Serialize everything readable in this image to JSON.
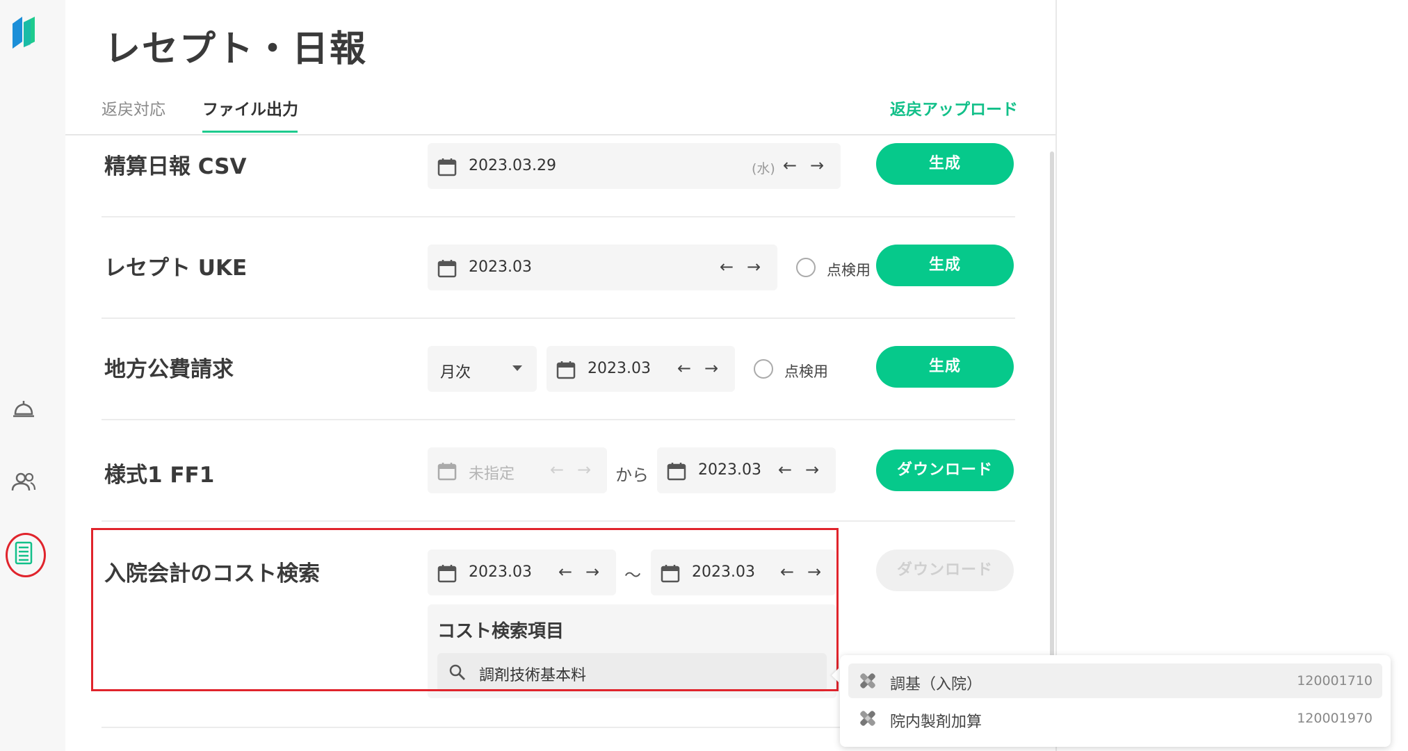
{
  "page": {
    "title": "レセプト・日報",
    "tabs": [
      {
        "label": "返戻対応",
        "active": false
      },
      {
        "label": "ファイル出力",
        "active": true
      }
    ],
    "upload_link": "返戻アップロード"
  },
  "colors": {
    "accent": "#06c98b",
    "annotation": "#e0242c"
  },
  "sidebar": {
    "icons": [
      "logo-icon",
      "bell-icon",
      "people-icon",
      "document-list-icon"
    ]
  },
  "rows": {
    "daily_csv": {
      "title": "精算日報 CSV",
      "date": "2023.03.29",
      "weekday": "(水)",
      "button": "生成"
    },
    "receipt_uke": {
      "title": "レセプト UKE",
      "date": "2023.03",
      "checkbox_label": "点検用",
      "button": "生成"
    },
    "local_public": {
      "title": "地方公費請求",
      "period_select": "月次",
      "date": "2023.03",
      "checkbox_label": "点検用",
      "button": "生成"
    },
    "form1_ff1": {
      "title": "様式1 FF1",
      "from_placeholder": "未指定",
      "from_text": "から",
      "to_date": "2023.03",
      "button": "ダウンロード"
    },
    "inpatient_cost": {
      "title": "入院会計のコスト検索",
      "start_date": "2023.03",
      "range_sep": "～",
      "end_date": "2023.03",
      "button": "ダウンロード",
      "cost_label": "コスト検索項目",
      "search_value": "調剤技術基本料"
    }
  },
  "dropdown": {
    "options": [
      {
        "label": "調基（入院）",
        "code": "120001710"
      },
      {
        "label": "院内製剤加算",
        "code": "120001970"
      }
    ]
  }
}
